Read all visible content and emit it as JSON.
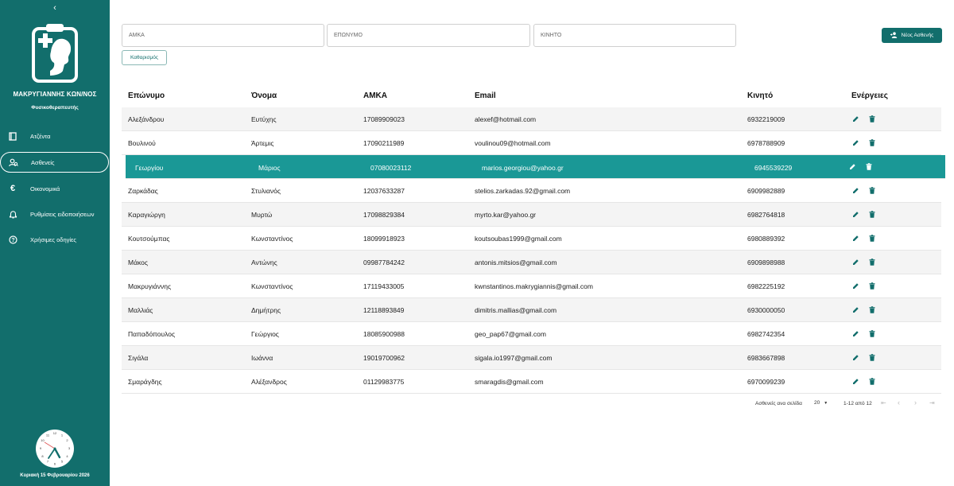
{
  "sidebar": {
    "collapse_glyph": "‹",
    "user_name": "ΜΑΚΡΥΓΙΑΝΝΗΣ ΚΩΝ/ΝΟΣ",
    "user_role": "Φυσικοθεραπευτής",
    "items": [
      {
        "label": "Ατζέντα",
        "icon": "calendar-icon"
      },
      {
        "label": "Ασθενείς",
        "icon": "patients-icon",
        "active": true
      },
      {
        "label": "Οικονομικά",
        "icon": "euro-icon"
      },
      {
        "label": "Ρυθμίσεις ειδοποιήσεων",
        "icon": "bell-icon"
      },
      {
        "label": "Χρήσιμες οδηγίες",
        "icon": "help-icon"
      }
    ],
    "date": "Κυριακή 15 Φεβρουαρίου 2026"
  },
  "search": {
    "amka_placeholder": "ΑΜΚΑ",
    "surname_placeholder": "ΕΠΩΝΥΜΟ",
    "mobile_placeholder": "ΚΙΝΗΤΟ",
    "clear_label": "Καθαρισμός",
    "new_patient_label": "Νέος Ασθενής"
  },
  "table": {
    "headers": {
      "surname": "Επώνυμο",
      "name": "Όνομα",
      "amka": "ΑΜΚΑ",
      "email": "Email",
      "mobile": "Κινητό",
      "actions": "Ενέργειες"
    },
    "rows": [
      {
        "surname": "Αλεξάνδρου",
        "name": "Ευτύχης",
        "amka": "17089909023",
        "email": "alexef@hotmail.com",
        "mobile": "6932219009"
      },
      {
        "surname": "Βουλινού",
        "name": "Άρτεμις",
        "amka": "17090211989",
        "email": "voulinou09@hotmail.com",
        "mobile": "6978788909"
      },
      {
        "surname": "Γεωργίου",
        "name": "Μάριος",
        "amka": "07080023112",
        "email": "marios.georgiou@yahoo.gr",
        "mobile": "6945539229"
      },
      {
        "surname": "Ζαρκάδας",
        "name": "Στυλιανός",
        "amka": "12037633287",
        "email": "stelios.zarkadas.92@gmail.com",
        "mobile": "6909982889"
      },
      {
        "surname": "Καραγιώργη",
        "name": "Μυρτώ",
        "amka": "17098829384",
        "email": "myrto.kar@yahoo.gr",
        "mobile": "6982764818"
      },
      {
        "surname": "Κουτσούμπας",
        "name": "Κωνσταντίνος",
        "amka": "18099918923",
        "email": "koutsoubas1999@gmail.com",
        "mobile": "6980889392"
      },
      {
        "surname": "Μάκος",
        "name": "Αντώνης",
        "amka": "09987784242",
        "email": "antonis.mitsios@gmail.com",
        "mobile": "6909898988"
      },
      {
        "surname": "Μακρυγιάννης",
        "name": "Κωνσταντίνος",
        "amka": "17119433005",
        "email": "kwnstantinos.makrygiannis@gmail.com",
        "mobile": "6982225192"
      },
      {
        "surname": "Μαλλιάς",
        "name": "Δημήτρης",
        "amka": "12118893849",
        "email": "dimitris.mallias@gmail.com",
        "mobile": "6930000050"
      },
      {
        "surname": "Παπαδόπουλος",
        "name": "Γεώργιος",
        "amka": "18085900988",
        "email": "geo_pap67@gmail.com",
        "mobile": "6982742354"
      },
      {
        "surname": "Σιγάλα",
        "name": "Ιωάννα",
        "amka": "19019700962",
        "email": "sigala.io1997@gmail.com",
        "mobile": "6983667898"
      },
      {
        "surname": "Σμαράγδης",
        "name": "Αλέξανδρος",
        "amka": "01129983775",
        "email": "smaragdis@gmail.com",
        "mobile": "6970099239"
      }
    ],
    "selected_row": 2
  },
  "pagination": {
    "rows_per_page_label": "Ασθενείς ανα σελίδα",
    "rows_per_page": "20",
    "range": "1-12 από 12"
  },
  "colors": {
    "primary": "#126e6c",
    "selected_row": "#1a9896",
    "alt_row": "#f4f4f4"
  }
}
